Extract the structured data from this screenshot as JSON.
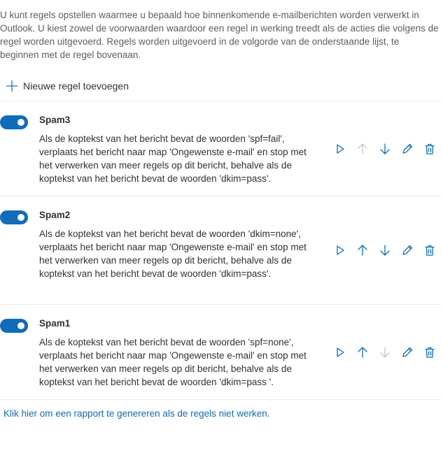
{
  "intro": {
    "text": "U kunt regels opstellen waarmee u bepaald hoe binnenkomende e-mailberichten worden verwerkt in Outlook. U kiest zowel de voorwaarden waardoor een regel in werking treedt als de acties die volgens de regel worden uitgevoerd. Regels worden uitgevoerd in de volgorde van de onderstaande lijst, te beginnen met de regel bovenaan."
  },
  "add_rule": {
    "label": "Nieuwe regel toevoegen",
    "icon": "plus-icon"
  },
  "rules": [
    {
      "name": "Spam3",
      "enabled": true,
      "description": "Als de koptekst van het bericht bevat de woorden 'spf=fail', verplaats het bericht naar map 'Ongewenste e-mail' en stop met het verwerken van meer regels op dit bericht, behalve als de koptekst van het bericht bevat de woorden 'dkim=pass'.",
      "move_up_enabled": false,
      "move_down_enabled": true
    },
    {
      "name": "Spam2",
      "enabled": true,
      "description": "Als de koptekst van het bericht bevat de woorden 'dkim=none', verplaats het bericht naar map 'Ongewenste e-mail' en stop met het verwerken van meer regels op dit bericht, behalve als de koptekst van het bericht bevat de woorden 'dkim=pass'.",
      "move_up_enabled": true,
      "move_down_enabled": true
    },
    {
      "name": "Spam1",
      "enabled": true,
      "description": "Als de koptekst van het bericht bevat de woorden 'spf=none', verplaats het bericht naar map 'Ongewenste e-mail' en stop met het verwerken van meer regels op dit bericht, behalve als de koptekst van het bericht bevat de woorden 'dkim=pass '.",
      "move_up_enabled": true,
      "move_down_enabled": false
    }
  ],
  "report_link": {
    "text": "Klik hier om een rapport te genereren als de regels niet werken."
  },
  "colors": {
    "accent": "#0f6cbd",
    "disabled": "#c8c6c4",
    "divider": "#edebe9",
    "muted_text": "#605e5c"
  }
}
